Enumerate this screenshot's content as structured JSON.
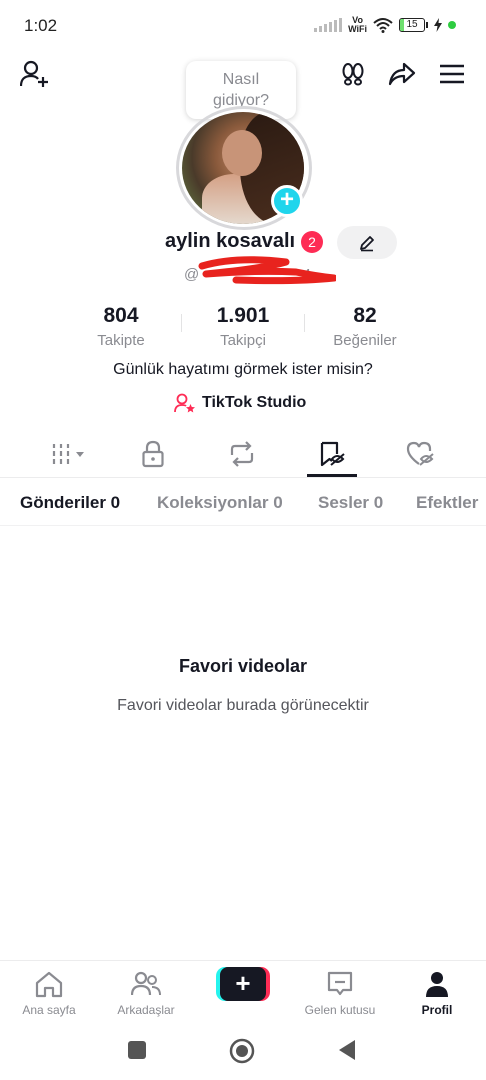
{
  "status_bar": {
    "time": "1:02",
    "network": "Vo\nWiFi",
    "battery": "15",
    "battery_level": 0.15
  },
  "header": {
    "bubble_text": "Nasıl\ngidiyor?"
  },
  "profile": {
    "username": "aylin kosavalı",
    "notification_count": "2",
    "handle_prefix": "@",
    "handle_suffix": "4"
  },
  "stats": [
    {
      "value": "804",
      "label": "Takipte"
    },
    {
      "value": "1.901",
      "label": "Takipçi"
    },
    {
      "value": "82",
      "label": "Beğeniler"
    }
  ],
  "bio": "Günlük hayatımı görmek ister misin?",
  "studio_label": "TikTok Studio",
  "sub_tabs": [
    {
      "label": "Gönderiler 0"
    },
    {
      "label": "Koleksiyonlar 0"
    },
    {
      "label": "Sesler 0"
    },
    {
      "label": "Efektler"
    }
  ],
  "empty_state": {
    "title": "Favori videolar",
    "subtitle": "Favori videolar burada görünecektir"
  },
  "bottom_nav": [
    {
      "label": "Ana sayfa"
    },
    {
      "label": "Arkadaşlar"
    },
    {
      "label": "Gelen kutusu"
    },
    {
      "label": "Profil"
    }
  ],
  "colors": {
    "accent_red": "#fe2c55",
    "accent_cyan": "#20d5ec",
    "text_primary": "#161823",
    "text_secondary": "#8a8b91"
  }
}
